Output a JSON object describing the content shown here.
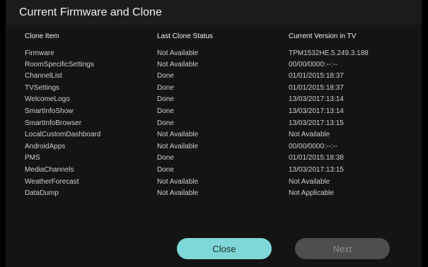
{
  "dialog": {
    "title": "Current Firmware and Clone"
  },
  "table": {
    "headers": [
      "Clone Item",
      "Last Clone Status",
      "Current Version in TV"
    ],
    "rows": [
      [
        "Firmware",
        "Not Available",
        "TPM1532HE.5.249.3.188"
      ],
      [
        "RoomSpecificSettings",
        "Not Available",
        "00/00/0000:--:--"
      ],
      [
        "ChannelList",
        "Done",
        "01/01/2015:18:37"
      ],
      [
        "TVSettings",
        "Done",
        "01/01/2015:18:37"
      ],
      [
        "WelcomeLogo",
        "Done",
        "13/03/2017:13:14"
      ],
      [
        "SmartInfoShow",
        "Done",
        "13/03/2017:13:14"
      ],
      [
        "SmartInfoBrowser",
        "Done",
        "13/03/2017:13:15"
      ],
      [
        "LocalCustomDashboard",
        "Not Available",
        "Not Available"
      ],
      [
        "AndroidApps",
        "Not Available",
        "00/00/0000:--:--"
      ],
      [
        "PMS",
        "Done",
        "01/01/2015:18:38"
      ],
      [
        "MediaChannels",
        "Done",
        "13/03/2017:13:15"
      ],
      [
        "WeatherForecast",
        "Not Available",
        "Not Available"
      ],
      [
        "DataDump",
        "Not Available",
        "Not Applicable"
      ]
    ]
  },
  "buttons": {
    "close_label": "Close",
    "next_label": "Next"
  },
  "colors": {
    "accent": "#7fd7d7",
    "disabled": "#4e4e4e"
  }
}
